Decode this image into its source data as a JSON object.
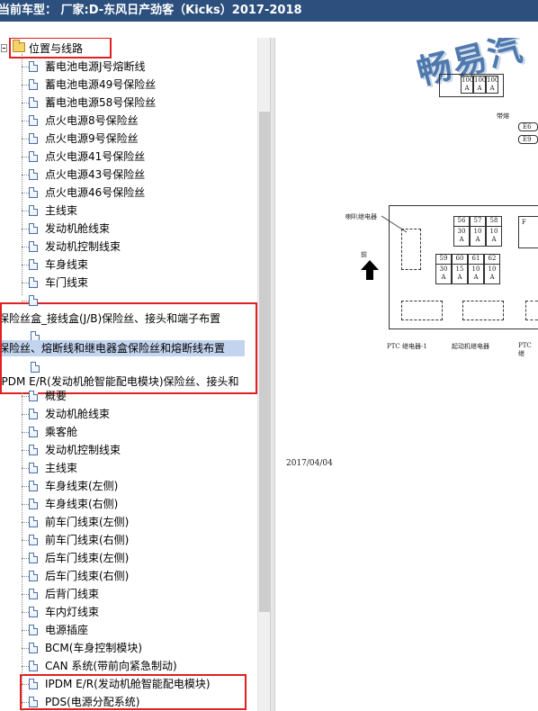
{
  "window": {
    "title": "当前车型： 厂家:D-东风日产劲客（Kicks）2017-2018"
  },
  "tree": {
    "root": {
      "label": "位置与线路"
    },
    "group1": [
      "蓄电池电源J号熔断线",
      "蓄电池电源49号保险丝",
      "蓄电池电源58号保险丝",
      "点火电源8号保险丝",
      "点火电源9号保险丝",
      "点火电源41号保险丝",
      "点火电源43号保险丝",
      "点火电源46号保险丝",
      "主线束",
      "发动机舱线束",
      "发动机控制线束",
      "车身线束",
      "车门线束"
    ],
    "section_a": "保险丝盒_接线盒(J/B)保险丝、接头和端子布置",
    "section_b": "保险丝、熔断线和继电器盒保险丝和熔断线布置",
    "section_c": "IPDM E/R(发动机舱智能配电模块)保险丝、接头和",
    "group2": [
      "概要",
      "发动机舱线束",
      "乘客舱",
      "发动机控制线束",
      "主线束",
      "车身线束(左侧)",
      "车身线束(右侧)",
      "前车门线束(左侧)",
      "前车门线束(右侧)",
      "后车门线束(左侧)",
      "后车门线束(右侧)",
      "后背门线束",
      "车内灯线束",
      "电源插座",
      "BCM(车身控制模块)",
      "CAN 系统(带前向紧急制动)",
      "IPDM E/R(发动机舱智能配电模块)",
      "PDS(电源分配系统)"
    ]
  },
  "diagram": {
    "watermark": "畅易汽",
    "top_cells": [
      "100",
      "100",
      "100"
    ],
    "top_cell_sub": [
      "A",
      "A",
      "A"
    ],
    "fusible_label": "带熔",
    "e6": "E6",
    "e9": "E9",
    "horn_relay": "喇叭继电器",
    "front": "前",
    "fuse_row1": [
      {
        "n": "56",
        "a": "30",
        "u": "A"
      },
      {
        "n": "57",
        "a": "10",
        "u": "A"
      },
      {
        "n": "58",
        "a": "10",
        "u": "A"
      }
    ],
    "fuse_row2": [
      {
        "n": "59",
        "a": "30",
        "u": "A"
      },
      {
        "n": "60",
        "a": "15",
        "u": "A"
      },
      {
        "n": "61",
        "a": "10",
        "u": "A"
      },
      {
        "n": "62",
        "a": "10",
        "u": "A"
      }
    ],
    "right_top": "F",
    "ptc1": "PTC 继电器-1",
    "starter": "起动机继电器",
    "ptc2": "PTC 继",
    "date": "2017/04/04"
  }
}
